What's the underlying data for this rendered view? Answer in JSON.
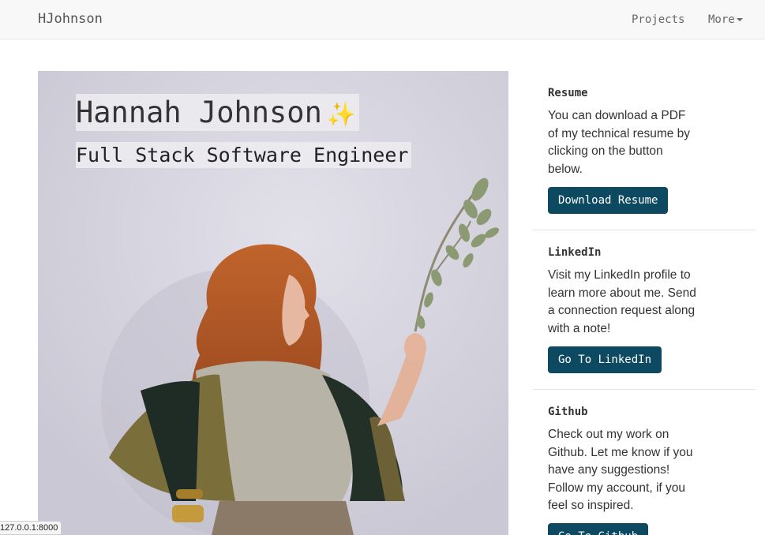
{
  "navbar": {
    "brand": "HJohnson",
    "links": [
      {
        "label": "Projects"
      },
      {
        "label": "More"
      }
    ]
  },
  "hero": {
    "title": "Hannah Johnson",
    "title_emoji": "✨",
    "subtitle": "Full Stack Software Engineer"
  },
  "sections": {
    "resume": {
      "heading": "Resume",
      "text": "You can download a PDF of my technical resume by clicking on the button below.",
      "button": "Download Resume"
    },
    "linkedin": {
      "heading": "LinkedIn",
      "text": "Visit my LinkedIn profile to learn more about me. Send a connection request along with a note!",
      "button": "Go To LinkedIn"
    },
    "github": {
      "heading": "Github",
      "text": "Check out my work on Github. Let me know if you have any suggestions! Follow my account, if you feel so inspired.",
      "button": "Go To Github"
    }
  },
  "status_bar": {
    "url": "127.0.0.1:8000"
  },
  "colors": {
    "button_bg": "#0d4a61",
    "navbar_bg": "#f8f8f8",
    "accent_sparkle": "#e6b832"
  }
}
